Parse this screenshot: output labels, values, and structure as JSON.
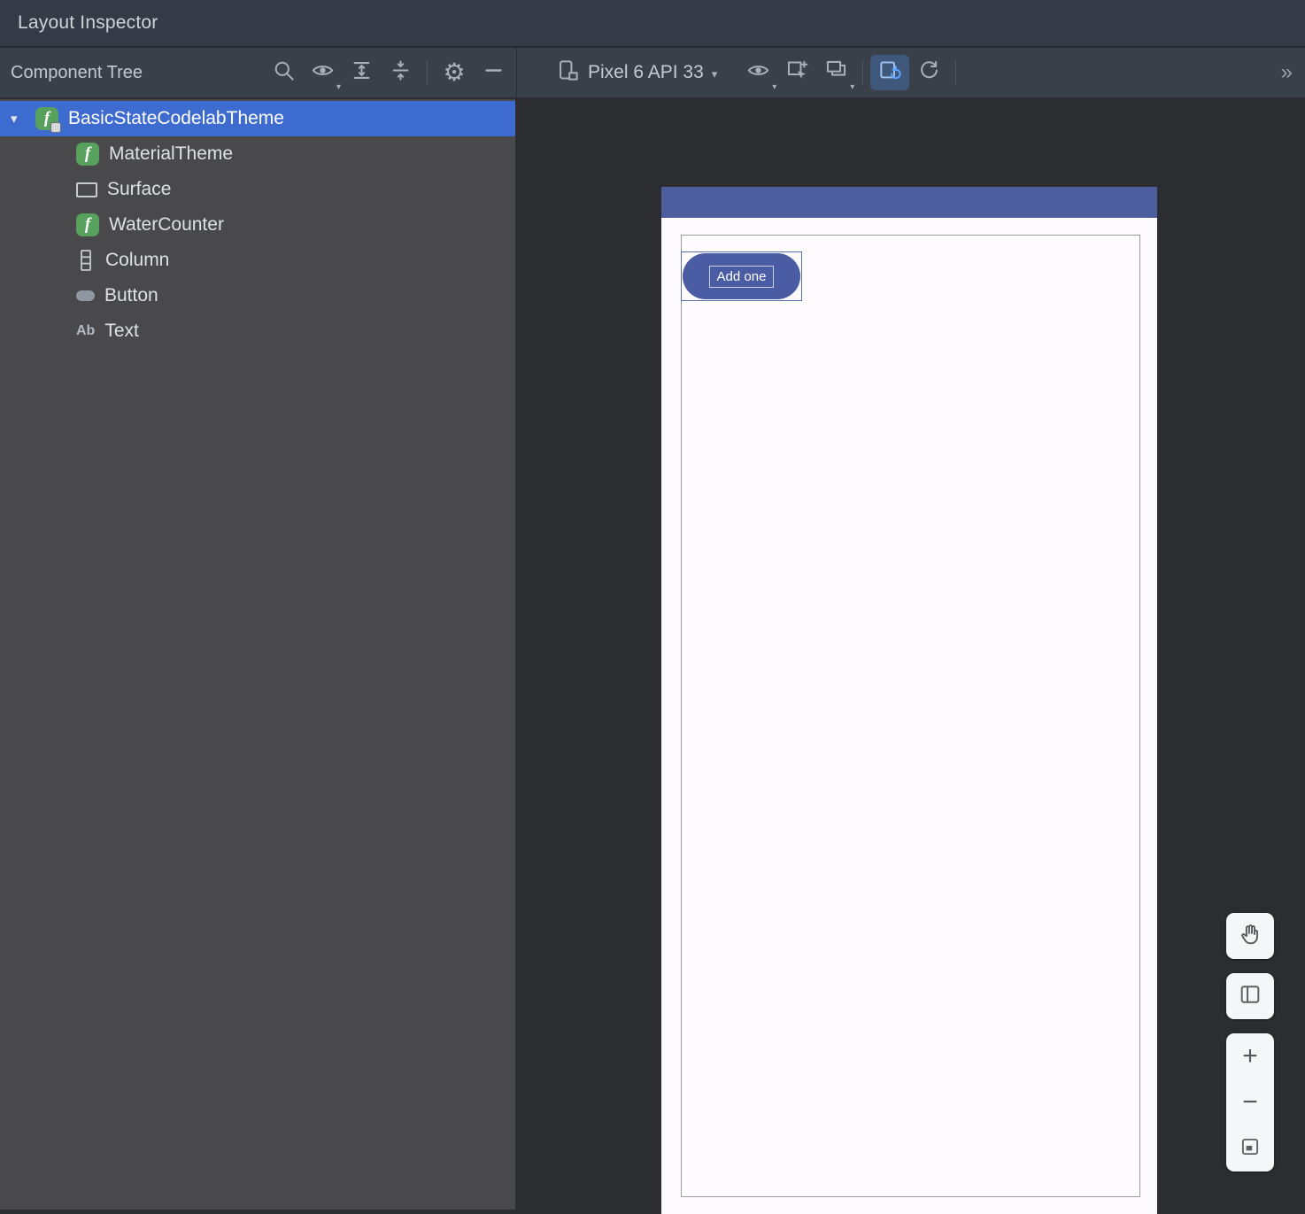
{
  "window": {
    "title": "Layout Inspector"
  },
  "toolbar": {
    "panel_title": "Component Tree",
    "device_label": "Pixel 6 API 33",
    "overflow": "»"
  },
  "icons": {
    "gear": "⚙",
    "chevron_down": "▾",
    "small_caret": "▾",
    "zoom_in": "+",
    "zoom_out": "−",
    "text_glyph": "Ab",
    "composable_glyph": "f"
  },
  "tree": {
    "items": [
      {
        "label": "BasicStateCodelabTheme",
        "icon": "composable-root",
        "selected": true,
        "expanded": true
      },
      {
        "label": "MaterialTheme",
        "icon": "composable",
        "selected": false
      },
      {
        "label": "Surface",
        "icon": "surface",
        "selected": false
      },
      {
        "label": "WaterCounter",
        "icon": "composable",
        "selected": false
      },
      {
        "label": "Column",
        "icon": "column",
        "selected": false
      },
      {
        "label": "Button",
        "icon": "button",
        "selected": false
      },
      {
        "label": "Text",
        "icon": "text",
        "selected": false
      }
    ]
  },
  "screen": {
    "button_label": "Add one"
  },
  "colors": {
    "selection_blue": "#3e6bd0",
    "statusbar_blue": "#4d5d9e",
    "material_button_blue": "#4a5ca3",
    "surface_white": "#fdfbfe",
    "panel_gray": "#49494b",
    "canvas_dark": "#2b2d30",
    "toolbar_dark": "#3a4049",
    "active_toggle_blue": "#4e8fe0"
  }
}
